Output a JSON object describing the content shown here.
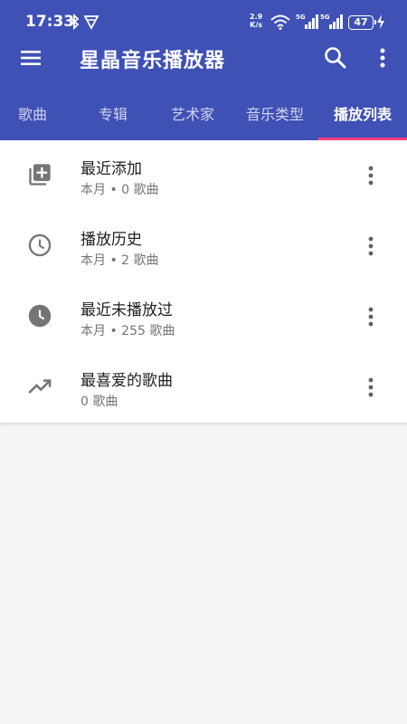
{
  "status_bar": {
    "time": "17:33",
    "net_speed_top": "2.9",
    "net_speed_bottom": "K/s",
    "signal1_label": "5G",
    "signal2_label": "5G",
    "battery": "47",
    "icons": [
      "bluetooth-icon",
      "vpn-icon",
      "wifi-icon",
      "signal-icon",
      "battery-icon",
      "charging-icon"
    ]
  },
  "app_bar": {
    "title": "星晶音乐播放器",
    "icons": [
      "menu-icon",
      "search-icon",
      "more-vert-icon"
    ]
  },
  "tabs": [
    {
      "label": "歌曲",
      "active": false
    },
    {
      "label": "专辑",
      "active": false
    },
    {
      "label": "艺术家",
      "active": false
    },
    {
      "label": "音乐类型",
      "active": false
    },
    {
      "label": "播放列表",
      "active": true
    }
  ],
  "playlists": [
    {
      "name": "最近添加",
      "subtitle": "本月 • 0 歌曲",
      "icon": "library-add-icon"
    },
    {
      "name": "播放历史",
      "subtitle": "本月 • 2 歌曲",
      "icon": "clock-outline-icon"
    },
    {
      "name": "最近未播放过",
      "subtitle": "本月 • 255 歌曲",
      "icon": "clock-filled-icon"
    },
    {
      "name": "最喜爱的歌曲",
      "subtitle": "0 歌曲",
      "icon": "trending-up-icon"
    }
  ],
  "colors": {
    "primary": "#3f51b5",
    "accent": "#ff4081",
    "icon_gray": "#757575",
    "background": "#f5f5f5"
  }
}
